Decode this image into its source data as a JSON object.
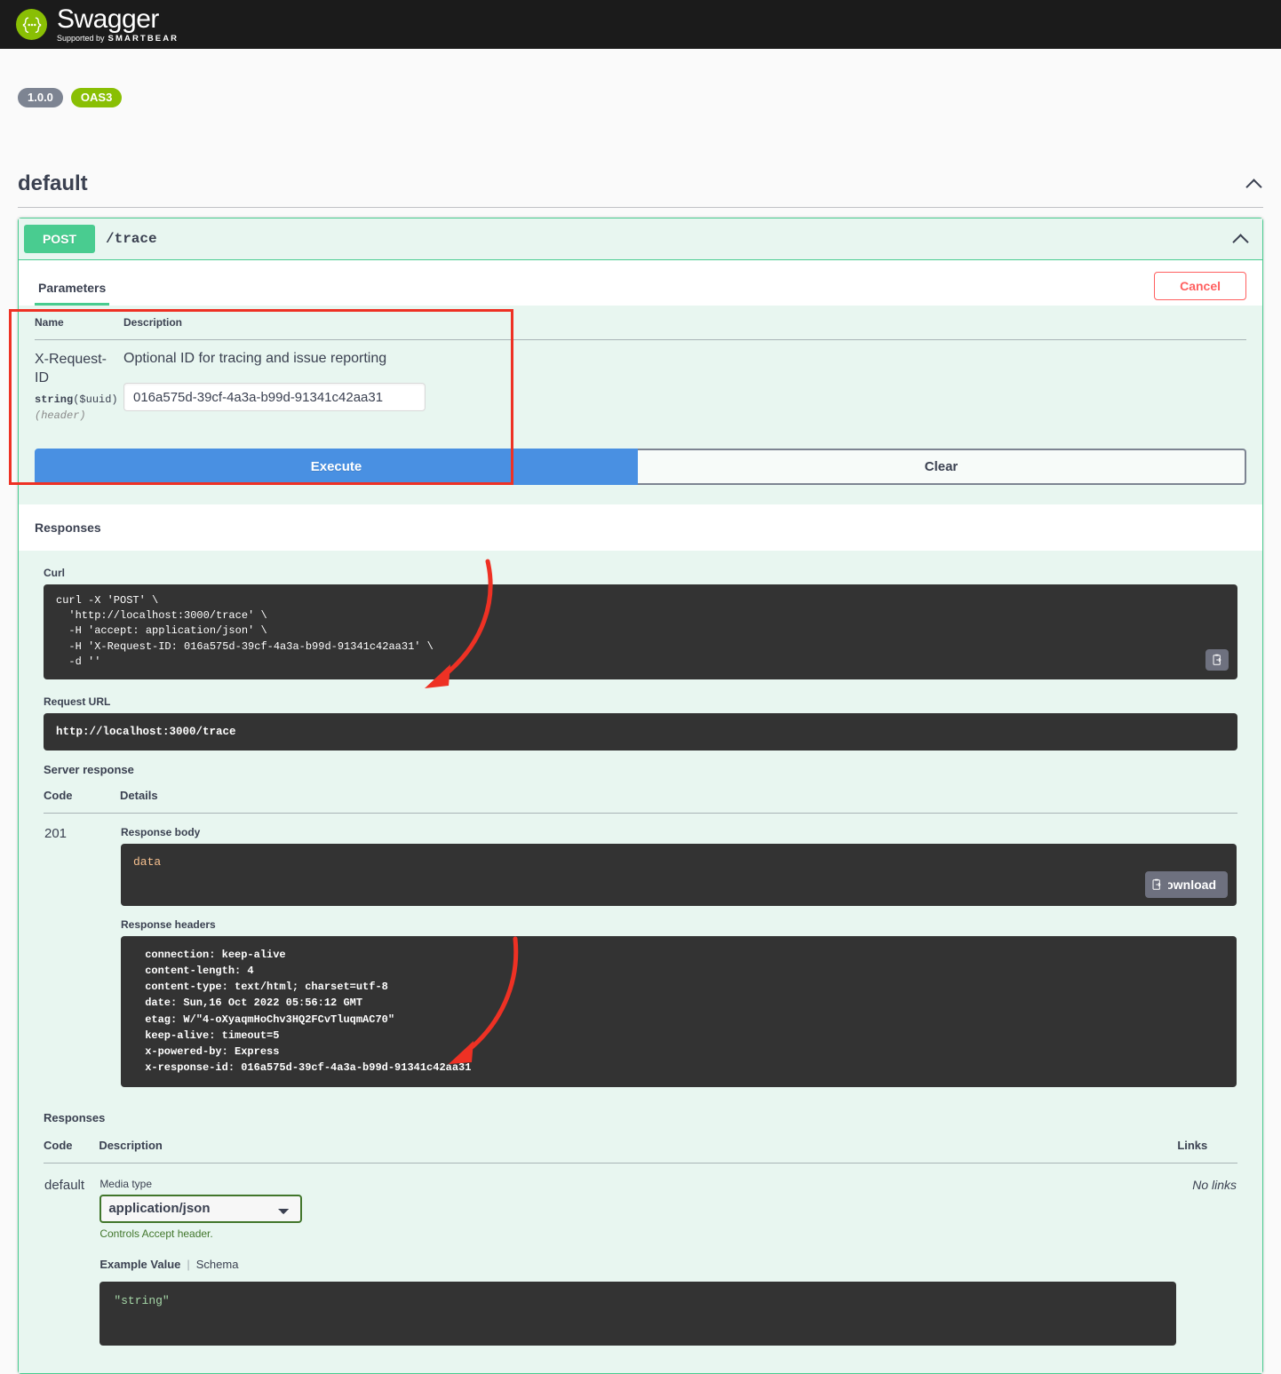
{
  "header": {
    "brand": "Swagger",
    "supported_prefix": "Supported by",
    "supported_brand": "SMARTBEAR",
    "logo_icon": "swagger-braces-icon"
  },
  "api_info": {
    "version_badge": "1.0.0",
    "spec_badge": "OAS3"
  },
  "tag": {
    "name": "default",
    "collapse_icon": "chevron-up-icon"
  },
  "operation": {
    "method": "POST",
    "path": "/trace",
    "collapse_icon": "chevron-up-icon",
    "tab_label": "Parameters",
    "cancel_label": "Cancel",
    "execute_label": "Execute",
    "clear_label": "Clear"
  },
  "parameters": {
    "columns": [
      "Name",
      "Description"
    ],
    "rows": [
      {
        "name": "X-Request-ID",
        "type": "string",
        "format": "($uuid)",
        "location": "(header)",
        "description": "Optional ID for tracing and issue reporting",
        "value": "016a575d-39cf-4a3a-b99d-91341c42aa31"
      }
    ]
  },
  "responses_section": {
    "title": "Responses",
    "curl_label": "Curl",
    "curl_lines": [
      "curl -X 'POST' \\",
      "  'http://localhost:3000/trace' \\",
      "  -H 'accept: application/json' \\",
      "  -H 'X-Request-ID: 016a575d-39cf-4a3a-b99d-91341c42aa31' \\",
      "  -d ''"
    ],
    "curl_copy_icon": "copy-to-clipboard-icon",
    "request_url_label": "Request URL",
    "request_url": "http://localhost:3000/trace",
    "server_response_label": "Server response",
    "columns": [
      "Code",
      "Details"
    ],
    "code": "201",
    "response_body_label": "Response body",
    "response_body": "data",
    "body_copy_icon": "copy-to-clipboard-icon",
    "download_label": "Download",
    "response_headers_label": "Response headers",
    "response_headers": [
      " connection: keep-alive ",
      " content-length: 4 ",
      " content-type: text/html; charset=utf-8 ",
      " date: Sun,16 Oct 2022 05:56:12 GMT ",
      " etag: W/\"4-oXyaqmHoChv3HQ2FCvTluqmAC70\" ",
      " keep-alive: timeout=5 ",
      " x-powered-by: Express ",
      " x-response-id: 016a575d-39cf-4a3a-b99d-91341c42aa31 "
    ]
  },
  "documented_responses": {
    "title": "Responses",
    "columns": [
      "Code",
      "Description",
      "Links"
    ],
    "code": "default",
    "links_text": "No links",
    "media_type_label": "Media type",
    "media_type_selected": "application/json",
    "media_type_options": [
      "application/json"
    ],
    "controls_note": "Controls Accept header.",
    "example_tab": "Example Value",
    "schema_tab": "Schema",
    "example_value": "\"string\""
  },
  "colors": {
    "brand_green": "#89bf04",
    "post_green": "#49cc90",
    "execute_blue": "#4990e2",
    "cancel_red": "#ff6060",
    "annotation_red": "#ee3124",
    "code_bg": "#333333",
    "panel_bg": "#e8f6f0"
  }
}
